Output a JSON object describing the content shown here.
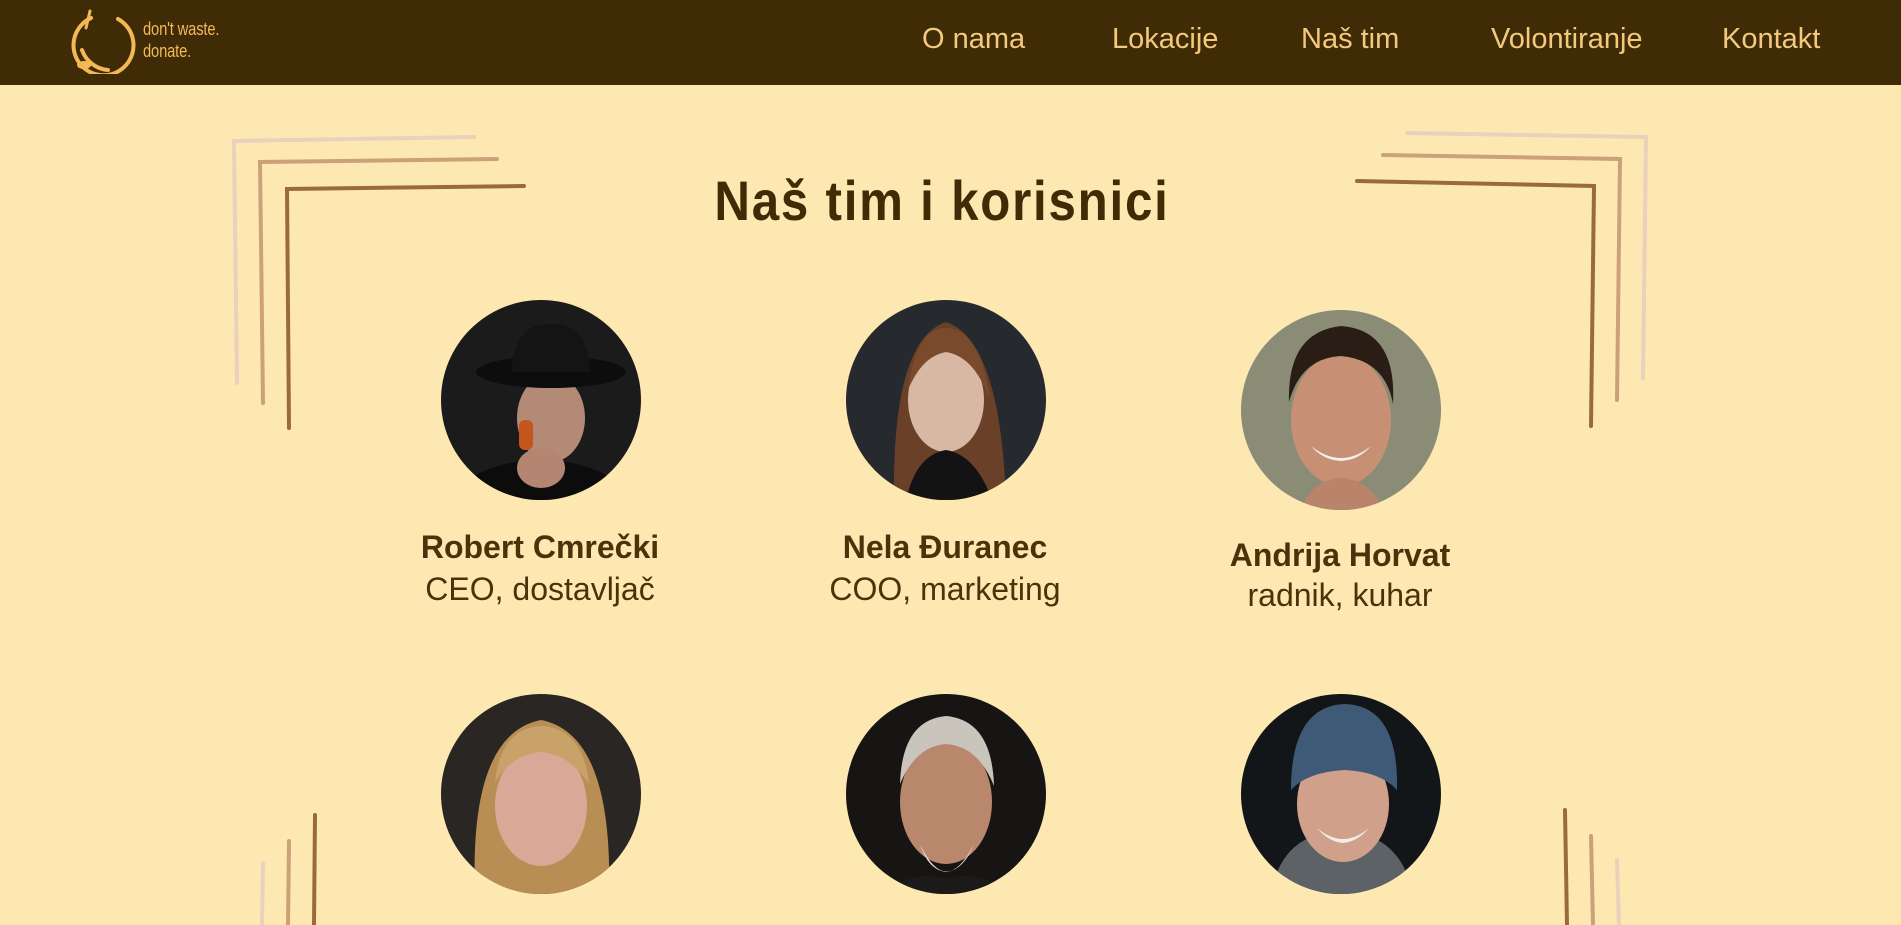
{
  "logo": {
    "line1": "don't waste.",
    "line2": "donate."
  },
  "nav": [
    {
      "label": "O nama"
    },
    {
      "label": "Lokacije"
    },
    {
      "label": "Naš tim"
    },
    {
      "label": "Volontiranje"
    },
    {
      "label": "Kontakt"
    }
  ],
  "title": "Naš tim i korisnici",
  "team": [
    {
      "name": "Robert Cmrečki",
      "role": "CEO, dostavljač"
    },
    {
      "name": "Nela Đuranec",
      "role": "COO, marketing"
    },
    {
      "name": "Andrija Horvat",
      "role": "radnik, kuhar"
    }
  ],
  "colors": {
    "header_bg": "#3f2b06",
    "page_bg": "#fee8b1",
    "accent": "#f3b955",
    "text": "#4a330a"
  }
}
